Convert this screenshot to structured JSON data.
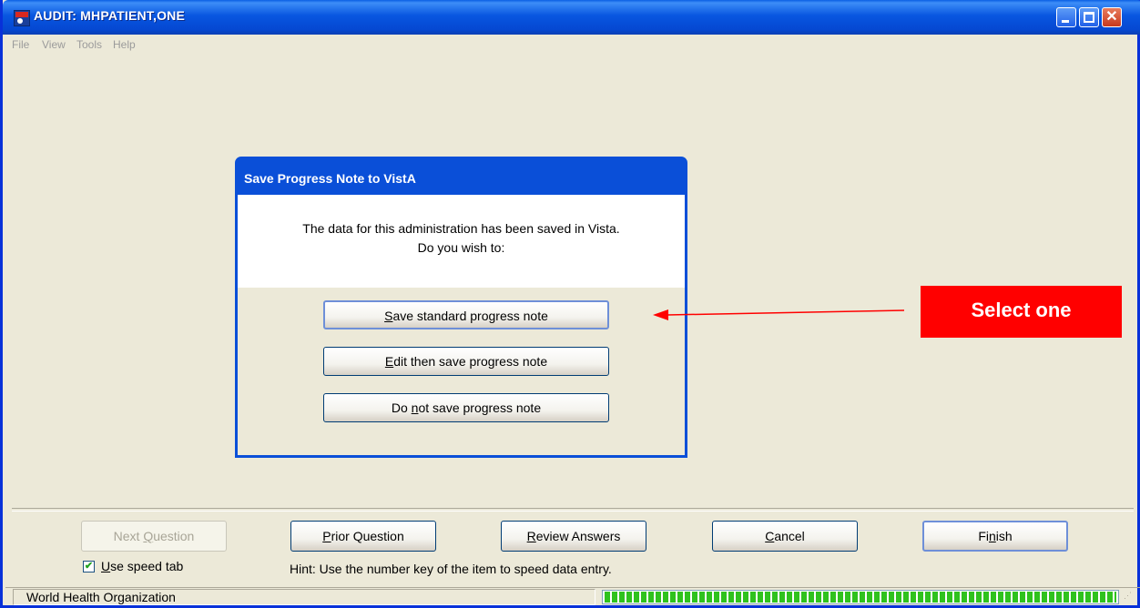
{
  "window": {
    "title": "AUDIT: MHPATIENT,ONE",
    "icon": "vista-app-icon",
    "controls": [
      "minimize-icon",
      "maximize-icon",
      "close-icon"
    ]
  },
  "menu": [
    "File",
    "View",
    "Tools",
    "Help"
  ],
  "dialog": {
    "title": "Save Progress Note to VistA",
    "message_line1": "The data for this administration has been saved in Vista.",
    "message_line2": "Do you wish to:",
    "buttons": [
      {
        "accel": "S",
        "rest": "ave standard progress note"
      },
      {
        "accel": "E",
        "rest": "dit then save progress note"
      },
      {
        "pre": "Do ",
        "accel": "n",
        "rest": "ot save progress note"
      }
    ]
  },
  "annotation": {
    "label": "Select one",
    "color": "#ff0000"
  },
  "bottom": {
    "buttons": [
      {
        "pre": "Next ",
        "accel": "Q",
        "rest": "uestion",
        "enabled": false
      },
      {
        "pre": "",
        "accel": "P",
        "rest": "rior Question",
        "enabled": true
      },
      {
        "pre": "",
        "accel": "R",
        "rest": "eview Answers",
        "enabled": true
      },
      {
        "pre": "",
        "accel": "C",
        "rest": "ancel",
        "enabled": true
      },
      {
        "pre": "Fi",
        "accel": "n",
        "rest": "ish",
        "enabled": true
      }
    ],
    "speed_tab": {
      "accel": "U",
      "rest": "se speed tab",
      "checked": true
    },
    "hint": "Hint: Use the number key of the item to speed data entry."
  },
  "status": {
    "text": "World Health Organization",
    "progress": 1.0,
    "progress_color": "#2fc21d"
  }
}
